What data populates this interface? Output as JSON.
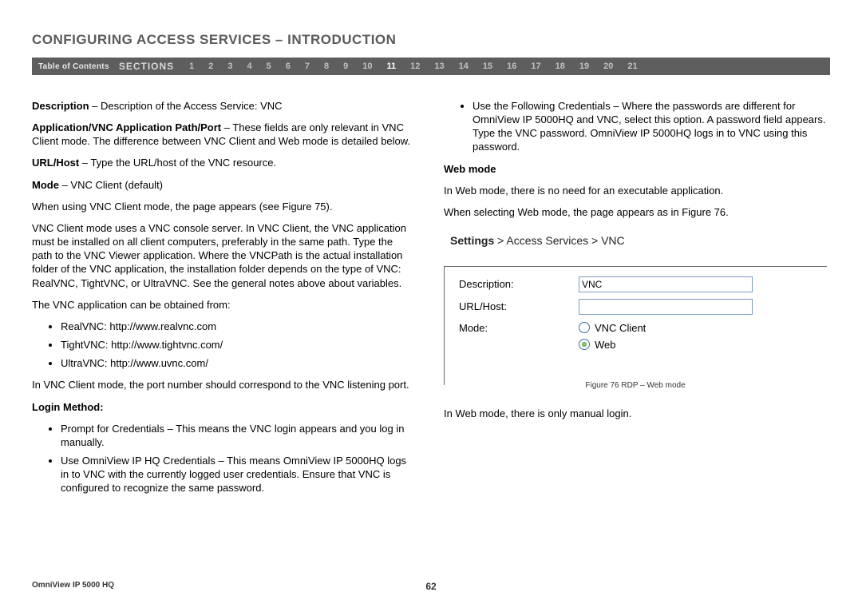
{
  "header": {
    "title": "CONFIGURING ACCESS SERVICES – INTRODUCTION"
  },
  "nav": {
    "toc": "Table of Contents",
    "sections_label": "SECTIONS",
    "items": [
      "1",
      "2",
      "3",
      "4",
      "5",
      "6",
      "7",
      "8",
      "9",
      "10",
      "11",
      "12",
      "13",
      "14",
      "15",
      "16",
      "17",
      "18",
      "19",
      "20",
      "21"
    ],
    "active": "11"
  },
  "left": {
    "p1": {
      "b": "Description",
      "t": " – Description of the Access Service: VNC"
    },
    "p2": {
      "b": "Application/VNC Application Path/Port",
      "t": " – These fields are only relevant in VNC Client mode. The difference between VNC Client and Web mode is detailed below."
    },
    "p3": {
      "b": "URL/Host",
      "t": " – Type the URL/host of the VNC resource."
    },
    "p4": {
      "b": "Mode",
      "t": " – VNC Client (default)"
    },
    "p5": "When using VNC Client mode, the page appears (see Figure 75).",
    "p6": "VNC Client mode uses a VNC console server. In VNC Client, the VNC application must be installed on all client computers, preferably in the same path. Type the path to the VNC Viewer application. Where the VNCPath is the actual installation folder of the VNC application, the installation folder depends on the type of VNC: RealVNC, TightVNC, or UltraVNC. See the general notes above about variables.",
    "p7": "The VNC application can be obtained from:",
    "links": [
      "RealVNC: http://www.realvnc.com",
      "TightVNC: http://www.tightvnc.com/",
      "UltraVNC: http://www.uvnc.com/"
    ],
    "p8": "In VNC Client mode, the port number should correspond to the VNC listening port.",
    "login_hdr": "Login Method:",
    "login_items": [
      "Prompt for Credentials – This means the VNC login appears and you log in manually.",
      "Use OmniView IP HQ Credentials – This means OmniView IP 5000HQ logs in to VNC with the currently logged user credentials. Ensure that VNC is configured to recognize the same password."
    ]
  },
  "right": {
    "top_bullet": "Use the Following Credentials – Where the passwords are different for OmniView IP 5000HQ and VNC, select this option. A password field appears. Type the VNC password. OmniView IP 5000HQ logs in to VNC using this password.",
    "web_hdr": "Web mode",
    "web_p1": "In Web mode, there is no need for an executable application.",
    "web_p2": "When selecting Web mode, the page appears as in Figure 76.",
    "breadcrumb": {
      "a": "Settings",
      "b": "Access Services",
      "c": "VNC"
    },
    "form": {
      "desc_label": "Description:",
      "desc_value": "VNC",
      "url_label": "URL/Host:",
      "url_value": "",
      "mode_label": "Mode:",
      "opt1": "VNC Client",
      "opt2": "Web",
      "selected": "Web"
    },
    "caption": "Figure 76 RDP – Web mode",
    "web_p3": "In Web mode, there is only manual login."
  },
  "footer": {
    "product": "OmniView IP 5000 HQ",
    "page": "62"
  }
}
